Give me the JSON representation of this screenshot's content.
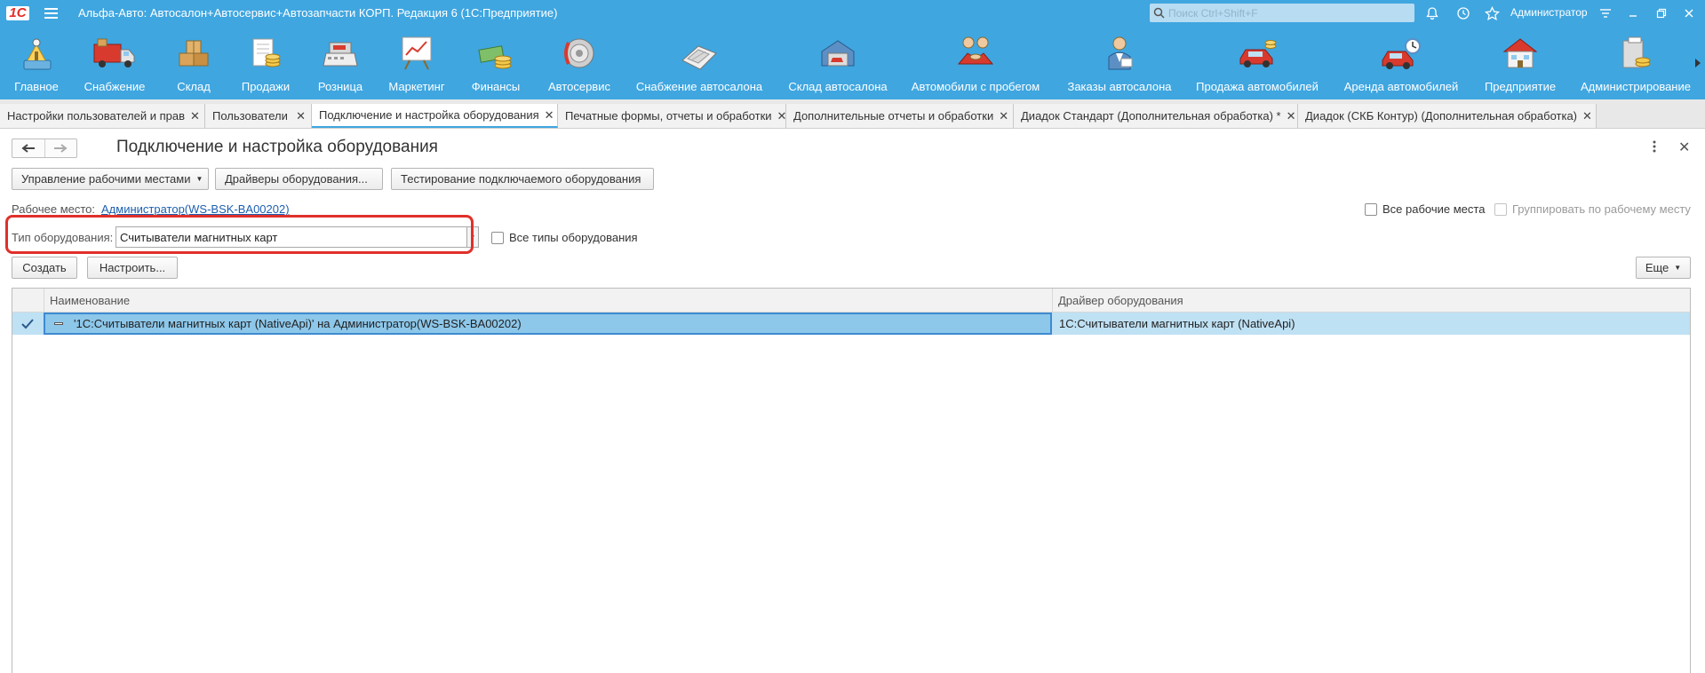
{
  "titlebar": {
    "logo": "1С",
    "app_title": "Альфа-Авто: Автосалон+Автосервис+Автозапчасти КОРП. Редакция 6  (1С:Предприятие)",
    "search_placeholder": "Поиск Ctrl+Shift+F",
    "user": "Администратор"
  },
  "sections": [
    {
      "label": "Главное",
      "icon": "home-icon"
    },
    {
      "label": "Снабжение",
      "icon": "truck-icon"
    },
    {
      "label": "Склад",
      "icon": "boxes-icon"
    },
    {
      "label": "Продажи",
      "icon": "sales-icon"
    },
    {
      "label": "Розница",
      "icon": "cash-register-icon"
    },
    {
      "label": "Маркетинг",
      "icon": "chart-board-icon"
    },
    {
      "label": "Финансы",
      "icon": "coins-icon"
    },
    {
      "label": "Автосервис",
      "icon": "brake-disc-icon"
    },
    {
      "label": "Снабжение автосалона",
      "icon": "calculator-icon"
    },
    {
      "label": "Склад автосалона",
      "icon": "garage-icon"
    },
    {
      "label": "Автомобили с пробегом",
      "icon": "handshake-icon"
    },
    {
      "label": "Заказы автосалона",
      "icon": "person-icon"
    },
    {
      "label": "Продажа автомобилей",
      "icon": "car-sale-icon"
    },
    {
      "label": "Аренда автомобилей",
      "icon": "car-rent-icon"
    },
    {
      "label": "Предприятие",
      "icon": "building-icon"
    },
    {
      "label": "Администрирование",
      "icon": "database-icon"
    }
  ],
  "tabs": [
    {
      "label": "Настройки пользователей и прав",
      "active": false
    },
    {
      "label": "Пользователи",
      "active": false
    },
    {
      "label": "Подключение и настройка оборудования",
      "active": true
    },
    {
      "label": "Печатные формы, отчеты и обработки",
      "active": false
    },
    {
      "label": "Дополнительные отчеты и обработки",
      "active": false
    },
    {
      "label": "Диадок Стандарт (Дополнительная обработка) *",
      "active": false
    },
    {
      "label": "Диадок (СКБ Контур) (Дополнительная обработка)",
      "active": false
    }
  ],
  "form": {
    "title": "Подключение и настройка оборудования",
    "toolbar": {
      "workplaces_label": "Управление рабочими местами",
      "drivers_label": "Драйверы оборудования...",
      "testing_label": "Тестирование подключаемого оборудования"
    },
    "workplace_label": "Рабочее место:",
    "workplace_value": "Администратор(WS-BSK-BA00202)",
    "all_workplaces_label": "Все рабочие места",
    "group_by_workplace_label": "Группировать по рабочему месту",
    "equipment_type_label": "Тип оборудования:",
    "equipment_type_value": "Считыватели магнитных карт",
    "all_types_label": "Все типы оборудования",
    "create_label": "Создать",
    "configure_label": "Настроить...",
    "more_label": "Еще"
  },
  "table": {
    "columns": [
      "Наименование",
      "Драйвер оборудования"
    ],
    "rows": [
      {
        "name": "'1С:Считыватели магнитных карт (NativeApi)' на Администратор(WS-BSK-BA00202)",
        "driver": "1С:Считыватели магнитных карт (NativeApi)"
      }
    ]
  },
  "colors": {
    "accent": "#3fa6e0",
    "highlight": "#e0302a",
    "row_selected": "#bfe1f4"
  }
}
